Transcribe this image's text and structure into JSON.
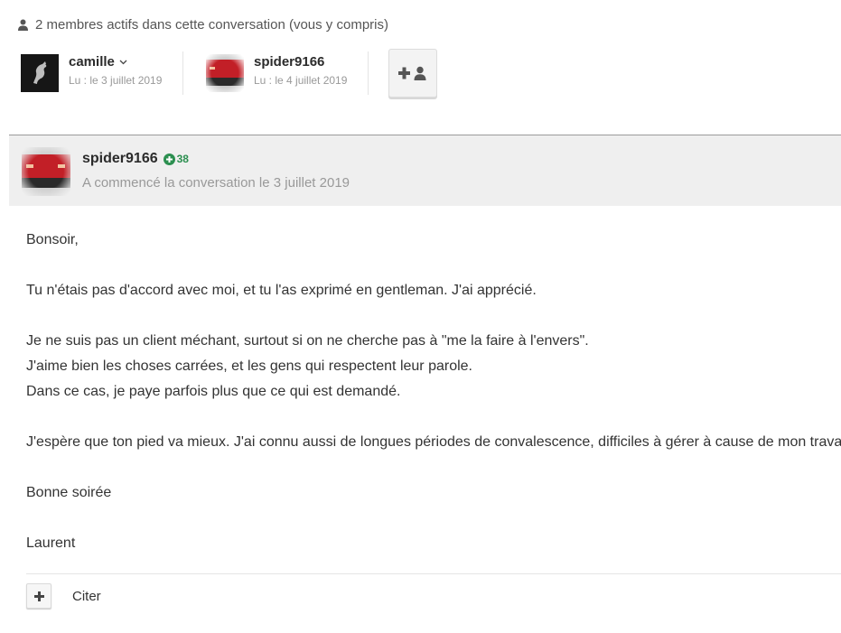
{
  "members": {
    "header": "2 membres actifs dans cette conversation (vous y compris)",
    "list": [
      {
        "name": "camille",
        "read": "Lu : le 3 juillet 2019"
      },
      {
        "name": "spider9166",
        "read": "Lu : le 4 juillet 2019"
      }
    ]
  },
  "post": {
    "author": "spider9166",
    "reputation": "38",
    "started": "A commencé la conversation le 3 juillet 2019",
    "lines": [
      "Bonsoir,",
      "",
      "Tu n'étais pas d'accord avec moi, et tu l'as exprimé en gentleman. J'ai apprécié.",
      "",
      "Je ne suis pas un client méchant, surtout si on ne cherche pas à \"me la faire à l'envers\".",
      "J'aime bien les choses carrées, et les gens qui respectent leur parole.",
      "Dans ce cas, je paye parfois plus que ce qui est demandé.",
      "",
      "J'espère que ton pied va mieux. J'ai connu aussi de longues périodes de convalescence, difficiles à gérer à cause de mon travail.",
      "",
      "Bonne soirée",
      "",
      "Laurent"
    ],
    "quote_label": "Citer"
  },
  "icons": {
    "person": "user-icon",
    "add_member": "add-user-icon",
    "chevron": "chevron-down-icon",
    "rep": "plus-circle-icon",
    "multiquote": "plus-icon"
  },
  "colors": {
    "rep_green": "#2c8f50",
    "muted": "#999999"
  }
}
